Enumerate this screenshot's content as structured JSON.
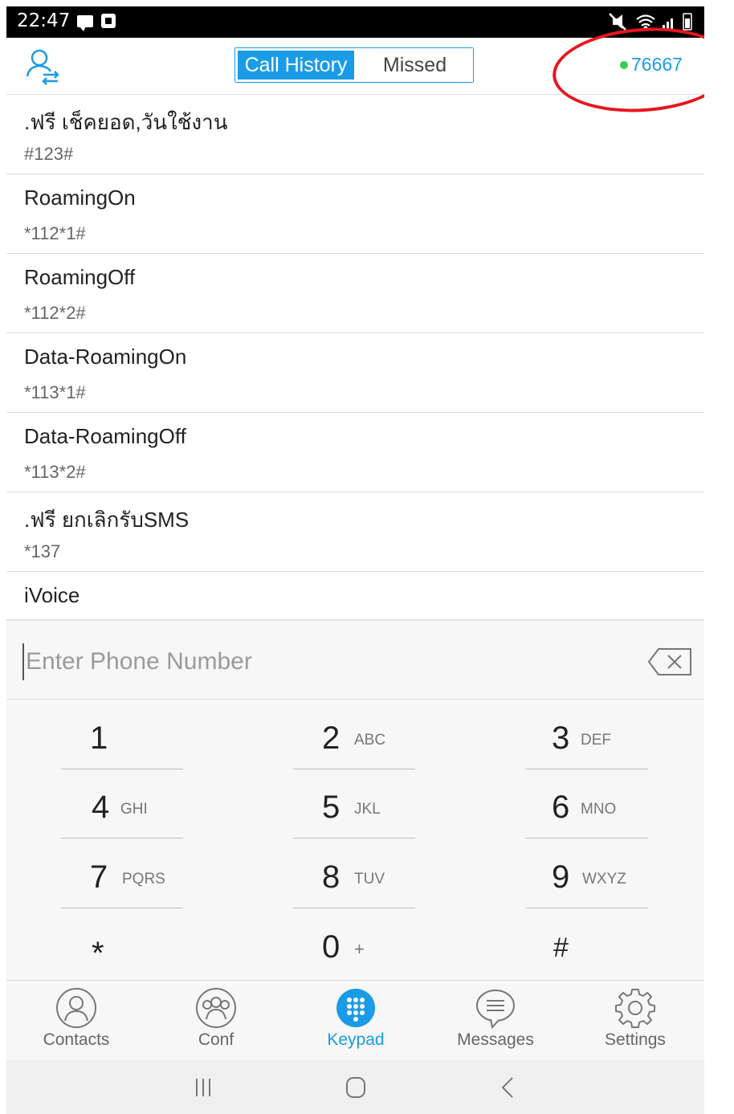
{
  "status_bar": {
    "time": "22:47"
  },
  "header": {
    "tabs": [
      {
        "label": "Call History",
        "active": true
      },
      {
        "label": "Missed",
        "active": false
      }
    ],
    "account_number": "76667",
    "account_status_color": "#33cc55",
    "accent_color": "#1a9be6",
    "highlight_color": "#e8161e"
  },
  "history": [
    {
      "name": ".ฟรี เช็คยอด,วันใช้งาน",
      "number": "#123#"
    },
    {
      "name": "RoamingOn",
      "number": "*112*1#"
    },
    {
      "name": "RoamingOff",
      "number": "*112*2#"
    },
    {
      "name": "Data-RoamingOn",
      "number": "*113*1#"
    },
    {
      "name": "Data-RoamingOff",
      "number": "*113*2#"
    },
    {
      "name": ".ฟรี ยกเลิกรับSMS",
      "number": "*137"
    },
    {
      "name": "iVoice",
      "number": ""
    }
  ],
  "dialer": {
    "placeholder": "Enter Phone Number",
    "value": "",
    "keys": [
      {
        "digit": "1",
        "letters": ""
      },
      {
        "digit": "2",
        "letters": "ABC"
      },
      {
        "digit": "3",
        "letters": "DEF"
      },
      {
        "digit": "4",
        "letters": "GHI"
      },
      {
        "digit": "5",
        "letters": "JKL"
      },
      {
        "digit": "6",
        "letters": "MNO"
      },
      {
        "digit": "7",
        "letters": "PQRS"
      },
      {
        "digit": "8",
        "letters": "TUV"
      },
      {
        "digit": "9",
        "letters": "WXYZ"
      },
      {
        "digit": "*",
        "letters": ""
      },
      {
        "digit": "0",
        "letters": "+"
      },
      {
        "digit": "#",
        "letters": ""
      }
    ]
  },
  "bottom_nav": [
    {
      "label": "Contacts",
      "icon": "contacts-icon",
      "active": false
    },
    {
      "label": "Conf",
      "icon": "conference-icon",
      "active": false
    },
    {
      "label": "Keypad",
      "icon": "keypad-icon",
      "active": true
    },
    {
      "label": "Messages",
      "icon": "messages-icon",
      "active": false
    },
    {
      "label": "Settings",
      "icon": "settings-icon",
      "active": false
    }
  ]
}
